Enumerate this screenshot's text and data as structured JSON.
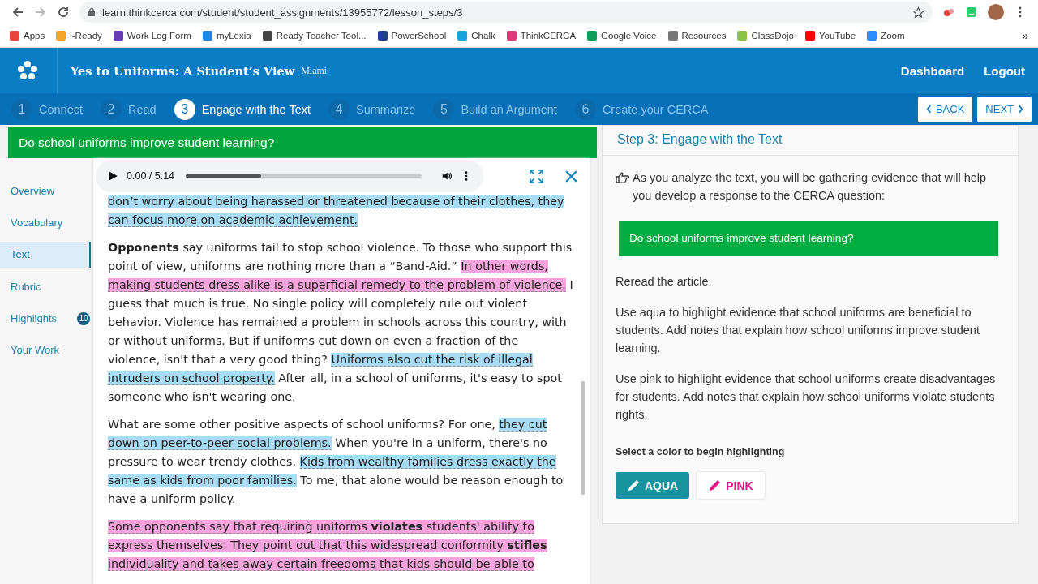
{
  "browser": {
    "url": "learn.thinkcerca.com/student/student_assignments/13955772/lesson_steps/3",
    "bookmarks": [
      {
        "label": "Apps",
        "color": "#e8453c"
      },
      {
        "label": "i-Ready",
        "color": "#f4a62a"
      },
      {
        "label": "Work Log Form",
        "color": "#673ab7"
      },
      {
        "label": "myLexia",
        "color": "#1e88e5"
      },
      {
        "label": "Ready Teacher Tool...",
        "color": "#444444"
      },
      {
        "label": "PowerSchool",
        "color": "#1c3f94"
      },
      {
        "label": "Chalk",
        "color": "#1ba1e2"
      },
      {
        "label": "ThinkCERCA",
        "color": "#d93a7a"
      },
      {
        "label": "Google Voice",
        "color": "#0f9d58"
      },
      {
        "label": "Resources",
        "color": "#777777"
      },
      {
        "label": "ClassDojo",
        "color": "#8bc34a"
      },
      {
        "label": "YouTube",
        "color": "#ff0000"
      },
      {
        "label": "Zoom",
        "color": "#2d8cff"
      }
    ],
    "overflow": "»"
  },
  "header": {
    "title": "Yes to Uniforms: A Student’s View",
    "subtitle": "Miami",
    "links": [
      "Dashboard",
      "Logout"
    ]
  },
  "steps": [
    {
      "number": "1",
      "label": "Connect",
      "selected": false
    },
    {
      "number": "2",
      "label": "Read",
      "selected": false
    },
    {
      "number": "3",
      "label": "Engage with the Text",
      "selected": true
    },
    {
      "number": "4",
      "label": "Summarize",
      "selected": false
    },
    {
      "number": "5",
      "label": "Build an Argument",
      "selected": false
    },
    {
      "number": "6",
      "label": "Create your CERCA",
      "selected": false
    }
  ],
  "step_buttons": [
    "BACK",
    "NEXT"
  ],
  "question": "Do school uniforms improve student learning?",
  "sidebar": {
    "items": [
      {
        "label": "Overview",
        "selected": false
      },
      {
        "label": "Vocabulary",
        "selected": false
      },
      {
        "label": "Text",
        "selected": true
      },
      {
        "label": "Rubric",
        "selected": false
      },
      {
        "label": "Highlights",
        "selected": false,
        "badge": "10"
      },
      {
        "label": "Your Work",
        "selected": false
      }
    ]
  },
  "audio": {
    "time": "0:00 / 5:14",
    "level": 0.32
  },
  "article": [
    {
      "segments": [
        {
          "text": "don’t worry about being harassed or threatened because of their clothes, they can focus more on academic achievement.",
          "color": "#a8dcf5"
        }
      ]
    },
    {
      "segments": [
        {
          "text": "**Opponents** say uniforms fail to stop school violence. To those who support this point of view, uniforms are nothing more than a “Band-Aid.” "
        },
        {
          "text": "In other words, making students dress alike is a superficial remedy to the problem of violence.",
          "color": "#f7a3dd"
        },
        {
          "text": " I guess that much is true. No single policy will completely rule out violent behavior. Violence has remained a problem in schools across this country, with or without uniforms. But if uniforms cut down on even a fraction of the violence, isn't that a very good thing? "
        },
        {
          "text": "Uniforms also cut the risk of illegal intruders on school property.",
          "color": "#a8dcf5"
        },
        {
          "text": " After all, in a school of uniforms, it's easy to spot someone who isn't wearing one."
        }
      ]
    },
    {
      "segments": [
        {
          "text": "What are some other positive aspects of school uniforms? For one, "
        },
        {
          "text": "they cut down on peer-to-peer social problems.",
          "color": "#a8dcf5"
        },
        {
          "text": " When you're in a uniform, there's no pressure to wear trendy clothes. "
        },
        {
          "text": "Kids from wealthy families dress exactly the same as kids from poor families.",
          "color": "#a8dcf5"
        },
        {
          "text": " To me, that alone would be reason enough to have a uniform policy."
        }
      ]
    },
    {
      "segments": [
        {
          "text": "Some opponents say that requiring uniforms **violates** students' ability to express themselves. They point out that this widespread conformity **stifles** individuality and takes away certain freedoms that kids should be able to",
          "color": "#f7a3dd"
        }
      ]
    }
  ],
  "panel": {
    "title": "Step 3: Engage with the Text",
    "intro": "As you analyze the text, you will be gathering evidence that will help you develop a response to the CERCA question:",
    "question": "Do school uniforms improve student learning?",
    "paragraphs": [
      "Reread the article.",
      "Use aqua to highlight evidence that school uniforms are beneficial to students. Add notes that explain how school uniforms improve student learning.",
      "Use pink to highlight evidence that school uniforms create disadvantages for students. Add notes that explain how school uniforms violate students rights."
    ],
    "prompt": "Select a color to begin highlighting",
    "colors": [
      {
        "label": "AQUA",
        "kind": "filled"
      },
      {
        "label": "PINK",
        "kind": "outline"
      }
    ]
  }
}
